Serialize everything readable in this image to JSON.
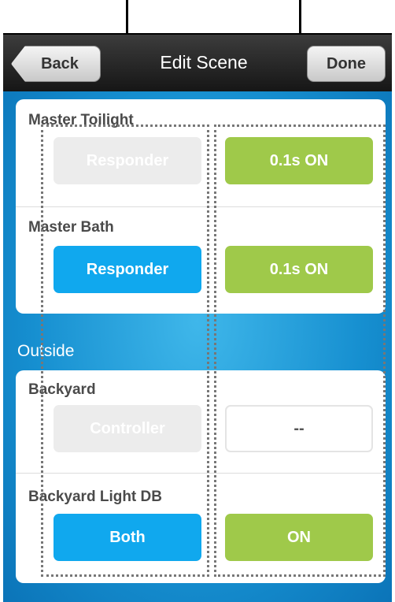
{
  "navbar": {
    "back_label": "Back",
    "title": "Edit Scene",
    "done_label": "Done"
  },
  "groups": [
    {
      "rows": [
        {
          "label": "Master Toilight",
          "role": "Responder",
          "role_state": "disabled",
          "action": "0.1s  ON",
          "action_state": "active"
        },
        {
          "label": "Master Bath",
          "role": "Responder",
          "role_state": "active",
          "action": "0.1s  ON",
          "action_state": "active"
        }
      ]
    },
    {
      "header": "Outside",
      "rows": [
        {
          "label": "Backyard",
          "role": "Controller",
          "role_state": "disabled",
          "action": "--",
          "action_state": "empty"
        },
        {
          "label": "Backyard Light DB",
          "role": "Both",
          "role_state": "active",
          "action": "ON",
          "action_state": "active"
        }
      ]
    }
  ],
  "colors": {
    "navbar": "#1f1f1f",
    "background_blue": "#168fd0",
    "role_blue": "#10a8ee",
    "action_green": "#9fc94a",
    "disabled_gray": "#ececec"
  }
}
